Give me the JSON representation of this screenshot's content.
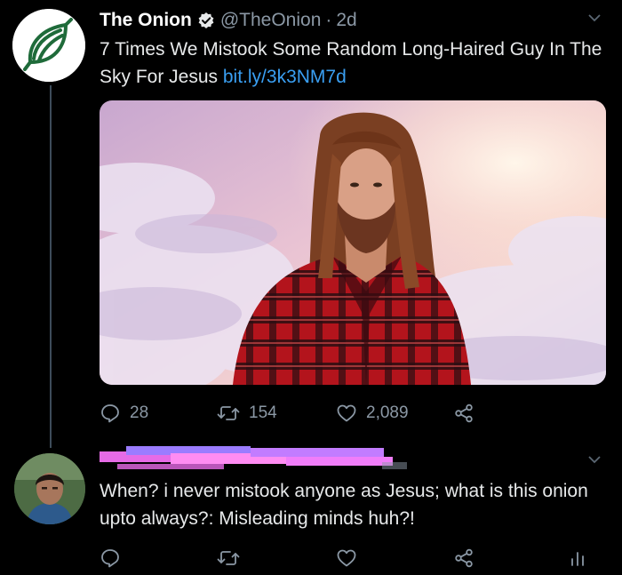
{
  "tweet": {
    "display_name": "The Onion",
    "handle": "@TheOnion",
    "separator": "·",
    "time": "2d",
    "text": "7 Times We Mistook Some Random Long-Haired Guy In The Sky For Jesus ",
    "link": "bit.ly/3k3NM7d",
    "replies": "28",
    "retweets": "154",
    "likes": "2,089"
  },
  "reply": {
    "text": "When? i never mistook anyone as Jesus; what is this onion upto always?: Misleading minds huh?!"
  },
  "icons": {
    "reply": "reply-icon",
    "retweet": "retweet-icon",
    "like": "heart-icon",
    "share": "share-icon",
    "analytics": "analytics-icon",
    "more": "chevron-down-icon",
    "verified": "verified-badge-icon"
  },
  "colors": {
    "background": "#000000",
    "text": "#e7e9ea",
    "muted": "#8b98a5",
    "link": "#3a9ff2",
    "onion_green": "#1f6b3a",
    "thread_line": "#3d4c5a"
  }
}
